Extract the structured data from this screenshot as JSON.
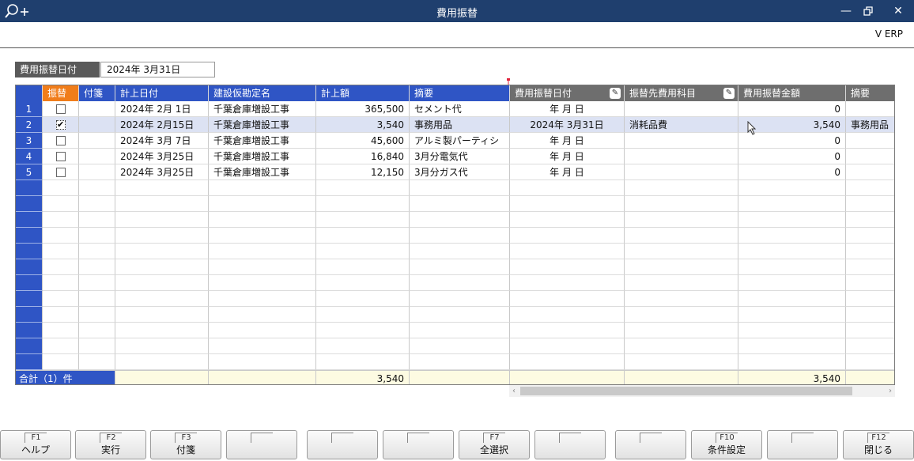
{
  "window": {
    "title": "費用振替",
    "brand": "V ERP",
    "icons": [
      "zoom-in-icon",
      "minimize-icon",
      "restore-icon",
      "close-icon"
    ]
  },
  "filter": {
    "label": "費用振替日付",
    "value": "2024年  3月31日"
  },
  "grid": {
    "headers": {
      "check": "振替",
      "note": "付箋",
      "post_date": "計上日付",
      "account": "建設仮勘定名",
      "amount": "計上額",
      "memo": "摘要",
      "transfer_date": "費用振替日付",
      "dest_account": "振替先費用科目",
      "transfer_amount": "費用振替金額",
      "memo2": "摘要"
    },
    "rows": [
      {
        "no": "1",
        "checked": false,
        "note": "",
        "post_date": "2024年  2月  1日",
        "account": "千葉倉庫増設工事",
        "amount": "365,500",
        "memo": "セメント代",
        "transfer_date": "年    月    日",
        "dest_account": "",
        "transfer_amount": "0",
        "memo2": ""
      },
      {
        "no": "2",
        "checked": true,
        "note": "",
        "post_date": "2024年  2月15日",
        "account": "千葉倉庫増設工事",
        "amount": "3,540",
        "memo": "事務用品",
        "transfer_date": "2024年  3月31日",
        "dest_account": "消耗品費",
        "transfer_amount": "3,540",
        "memo2": "事務用品"
      },
      {
        "no": "3",
        "checked": false,
        "note": "",
        "post_date": "2024年  3月  7日",
        "account": "千葉倉庫増設工事",
        "amount": "45,600",
        "memo": "アルミ製パーティシ",
        "transfer_date": "年    月    日",
        "dest_account": "",
        "transfer_amount": "0",
        "memo2": ""
      },
      {
        "no": "4",
        "checked": false,
        "note": "",
        "post_date": "2024年  3月25日",
        "account": "千葉倉庫増設工事",
        "amount": "16,840",
        "memo": "3月分電気代",
        "transfer_date": "年    月    日",
        "dest_account": "",
        "transfer_amount": "0",
        "memo2": ""
      },
      {
        "no": "5",
        "checked": false,
        "note": "",
        "post_date": "2024年  3月25日",
        "account": "千葉倉庫増設工事",
        "amount": "12,150",
        "memo": "3月分ガス代",
        "transfer_date": "年    月    日",
        "dest_account": "",
        "transfer_amount": "0",
        "memo2": ""
      }
    ],
    "total": {
      "label": "合計（1）件",
      "amount": "3,540",
      "transfer_amount": "3,540"
    }
  },
  "function_keys": [
    {
      "key": "F1",
      "label": "ヘルプ"
    },
    {
      "key": "F2",
      "label": "実行"
    },
    {
      "key": "F3",
      "label": "付箋"
    },
    {
      "key": "",
      "label": ""
    },
    {
      "key": "",
      "label": ""
    },
    {
      "key": "",
      "label": ""
    },
    {
      "key": "F7",
      "label": "全選択"
    },
    {
      "key": "",
      "label": ""
    },
    {
      "key": "",
      "label": ""
    },
    {
      "key": "F10",
      "label": "条件設定"
    },
    {
      "key": "",
      "label": ""
    },
    {
      "key": "F12",
      "label": "閉じる"
    }
  ],
  "colors": {
    "title_bar": "#1f3f6e",
    "header_blue": "#2f55c5",
    "header_gray": "#6e6e6e",
    "header_orange": "#f07d1a",
    "selected_row": "#dce2f3",
    "total_row": "#fdfbe2"
  }
}
